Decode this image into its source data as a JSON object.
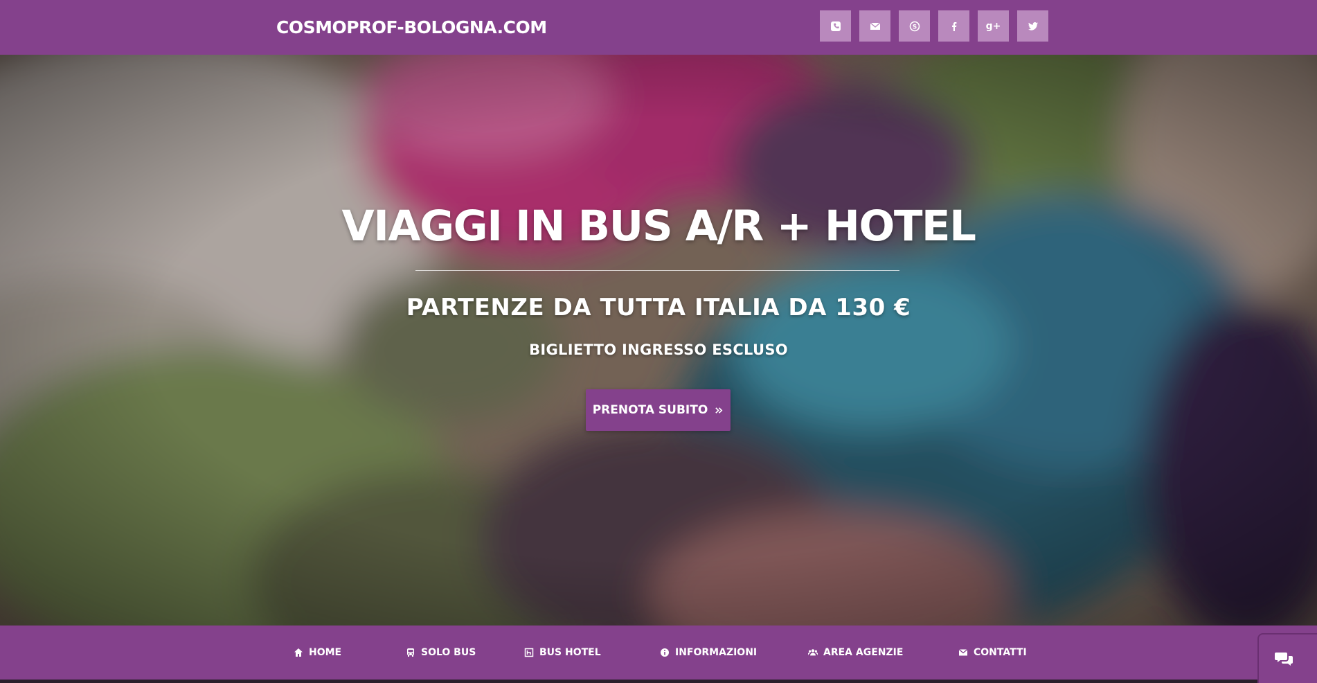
{
  "header": {
    "brand": "COSMOPROF-BOLOGNA.COM",
    "social_icons": [
      "phone-icon",
      "envelope-icon",
      "skype-icon",
      "facebook-icon",
      "google-plus-icon",
      "twitter-icon"
    ],
    "google_plus_glyph": "g+"
  },
  "hero": {
    "title": "VIAGGI IN BUS A/R + HOTEL",
    "subtitle": "PARTENZE DA TUTTA ITALIA DA 130 €",
    "note": "BIGLIETTO INGRESSO ESCLUSO",
    "cta_label": "PRENOTA SUBITO"
  },
  "nav": {
    "items": [
      {
        "label": "HOME",
        "icon": "home-icon"
      },
      {
        "label": "SOLO BUS",
        "icon": "bus-icon"
      },
      {
        "label": "BUS HOTEL",
        "icon": "hotel-icon"
      },
      {
        "label": "INFORMAZIONI",
        "icon": "info-icon"
      },
      {
        "label": "AREA AGENZIE",
        "icon": "users-icon"
      },
      {
        "label": "CONTATTI",
        "icon": "envelope-icon"
      }
    ]
  },
  "colors": {
    "brand_purple": "#84418c",
    "social_button": "#b989bd"
  }
}
